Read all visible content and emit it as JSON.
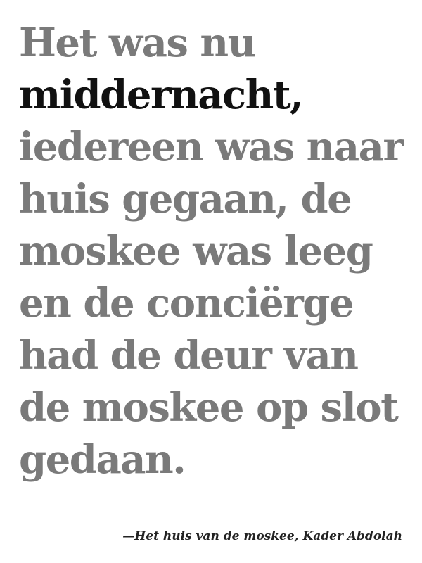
{
  "quote": {
    "lines": [
      "Het was nu",
      "middernacht,",
      "iedereen was naar",
      "huis gegaan, de",
      "moskee was leeg",
      "en de conciërge",
      "had de deur van",
      "de moskee op slot",
      "gedaan."
    ],
    "highlight_line_index": 1
  },
  "attribution": "—Het huis van de moskee, Kader Abdolah",
  "colors": {
    "body_text": "#7a7a7a",
    "highlight_text": "#111111",
    "background": "#ffffff"
  }
}
